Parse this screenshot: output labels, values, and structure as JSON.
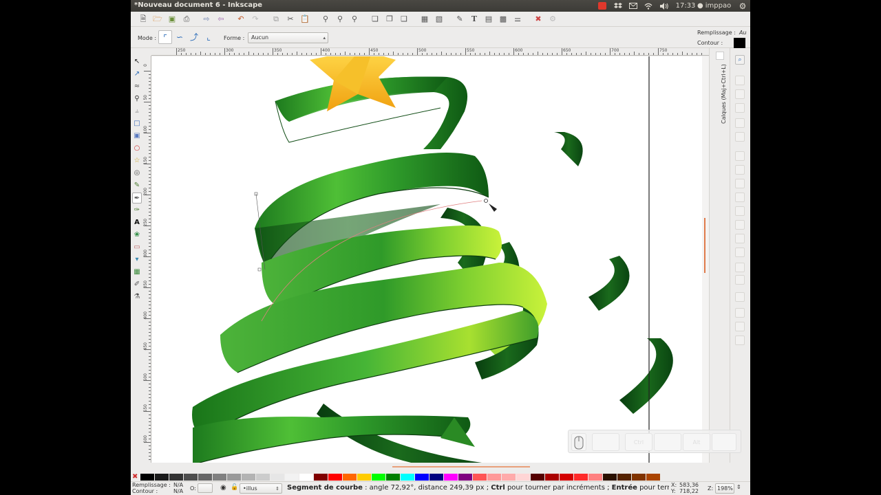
{
  "window": {
    "title": "*Nouveau document 6 - Inkscape"
  },
  "panel": {
    "time": "17:33",
    "user": "imppao",
    "icons": [
      "mail-icon",
      "wifi-icon",
      "volume-icon",
      "settings-gear-icon"
    ]
  },
  "commands_bar": {
    "icons": [
      "new-icon",
      "open-icon",
      "save-icon",
      "print-icon",
      "import-icon",
      "export-icon",
      "undo-icon",
      "redo-icon",
      "copy-icon",
      "cut-icon",
      "paste-icon",
      "zoom-selection-icon",
      "zoom-drawing-icon",
      "zoom-page-icon",
      "duplicate-icon",
      "clone-icon",
      "unlink-clone-icon",
      "group-icon",
      "ungroup-icon",
      "fill-stroke-icon",
      "text-font-icon",
      "layers-icon",
      "xml-editor-icon",
      "align-icon",
      "preferences-icon",
      "document-properties-icon"
    ]
  },
  "controls_bar": {
    "mode_label": "Mode :",
    "shape_label": "Forme :",
    "shape_value": "Aucun",
    "fill_label": "Remplissage :",
    "fill_value": "Au",
    "stroke_label": "Contour :"
  },
  "ruler_h": [
    "250",
    "300",
    "350",
    "400",
    "450",
    "500",
    "550",
    "600",
    "650",
    "700",
    "750"
  ],
  "ruler_v": [
    "0",
    "50",
    "100",
    "150",
    "200",
    "250",
    "300",
    "350",
    "400",
    "450",
    "500",
    "550",
    "600",
    "650"
  ],
  "toolbox": [
    "selector-tool",
    "node-tool",
    "tweak-tool",
    "zoom-tool",
    "measure-tool",
    "rectangle-tool",
    "3dbox-tool",
    "ellipse-tool",
    "star-tool",
    "spiral-tool",
    "pencil-tool",
    "pen-tool",
    "calligraphy-tool",
    "text-tool",
    "spray-tool",
    "eraser-tool",
    "bucket-tool",
    "gradient-tool",
    "dropper-tool",
    "connector-tool"
  ],
  "dock": {
    "layers_label": "Calques (Maj+Ctrl+L)"
  },
  "key_overlay": {
    "mouse": "",
    "keys": [
      "Ctrl",
      "Alt",
      ""
    ]
  },
  "palette": {
    "colors": [
      "#000000",
      "#1a1a1a",
      "#333333",
      "#4d4d4d",
      "#666666",
      "#808080",
      "#999999",
      "#b3b3b3",
      "#cccccc",
      "#e6e6e6",
      "#f2f2f2",
      "#ffffff",
      "#800000",
      "#ff0000",
      "#ff6600",
      "#ffcc00",
      "#00ff00",
      "#008000",
      "#00ffff",
      "#0000ff",
      "#000080",
      "#ff00ff",
      "#800080",
      "#ff5555",
      "#ff9999",
      "#ffaaaa",
      "#ffd5d5",
      "#550000",
      "#aa0000",
      "#d40000",
      "#ff2a2a",
      "#ff8080",
      "#2b1100",
      "#552200",
      "#803300",
      "#aa4400"
    ]
  },
  "status": {
    "fill_label": "Remplissage :",
    "fill_value": "N/A",
    "stroke_label": "Contour :",
    "stroke_value": "N/A",
    "opacity_label": "O:",
    "layer_value": "•illus",
    "msg_bold1": "Segment de courbe",
    "msg_text1": " : angle 72,92°, distance 249,39 px ; ",
    "msg_bold2": "Ctrl",
    "msg_text2": " pour tourner par incréments ; ",
    "msg_bold3": "Entrée",
    "msg_text3": " pour terminer le ch",
    "x_label": "X:",
    "x_value": "583,36",
    "y_label": "Y:",
    "y_value": "718,22",
    "z_label": "Z:",
    "zoom_value": "198%"
  }
}
